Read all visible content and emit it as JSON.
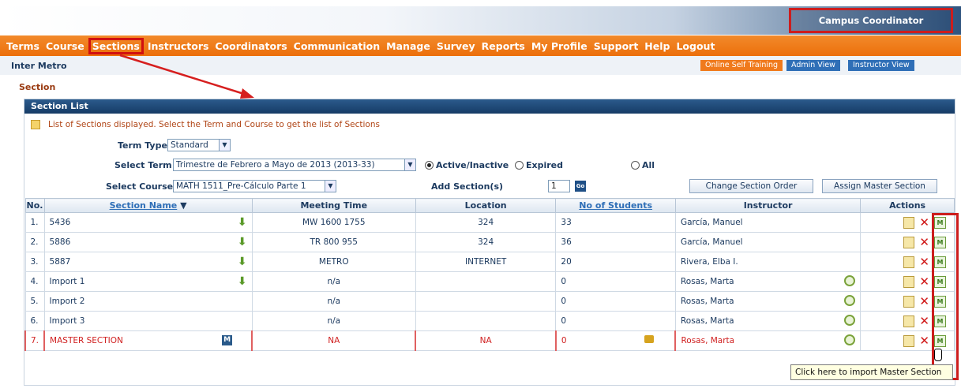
{
  "header": {
    "role": "Campus Coordinator"
  },
  "menu": [
    {
      "label": "Terms"
    },
    {
      "label": "Course"
    },
    {
      "label": "Sections",
      "active": true
    },
    {
      "label": "Instructors"
    },
    {
      "label": "Coordinators"
    },
    {
      "label": "Communication"
    },
    {
      "label": "Manage"
    },
    {
      "label": "Survey"
    },
    {
      "label": "Reports"
    },
    {
      "label": "My Profile"
    },
    {
      "label": "Support"
    },
    {
      "label": "Help"
    },
    {
      "label": "Logout"
    }
  ],
  "subbar": {
    "institution": "Inter Metro",
    "online_training": "Online Self Training",
    "admin_view": "Admin View",
    "instructor_view": "Instructor View"
  },
  "page": {
    "section_label": "Section",
    "panel_title": "Section List",
    "info": "List of Sections displayed. Select the Term and Course to get the list of Sections"
  },
  "form": {
    "term_type_label": "Term Type",
    "term_type_value": "Standard",
    "select_term_label": "Select Term",
    "select_term_value": "Trimestre de Febrero a Mayo de 2013 (2013-33)",
    "radio_active": "Active/Inactive",
    "radio_expired": "Expired",
    "radio_all": "All",
    "select_course_label": "Select Course",
    "select_course_value": "MATH 1511_Pre-Cálculo Parte 1",
    "add_sections_label": "Add Section(s)",
    "add_sections_value": "1",
    "go_label": "Go",
    "change_order_button": "Change Section Order",
    "assign_master_button": "Assign Master Section"
  },
  "table": {
    "headers": {
      "no": "No.",
      "section_name": "Section Name",
      "sort_glyph": "▼",
      "meeting_time": "Meeting Time",
      "location": "Location",
      "students": "No of Students",
      "instructor": "Instructor",
      "actions": "Actions"
    },
    "rows": [
      {
        "no": "1.",
        "name": "5436",
        "meeting": "MW 1600 1755",
        "location": "324",
        "students": "33",
        "instructor": "García, Manuel"
      },
      {
        "no": "2.",
        "name": "5886",
        "meeting": "TR 800 955",
        "location": "324",
        "students": "36",
        "instructor": "García, Manuel"
      },
      {
        "no": "3.",
        "name": "5887",
        "meeting": "METRO",
        "location": "INTERNET",
        "students": "20",
        "instructor": "Rivera, Elba I."
      },
      {
        "no": "4.",
        "name": "Import 1",
        "meeting": "n/a",
        "location": "",
        "students": "0",
        "instructor": "Rosas, Marta"
      },
      {
        "no": "5.",
        "name": "Import 2",
        "meeting": "n/a",
        "location": "",
        "students": "0",
        "instructor": "Rosas, Marta"
      },
      {
        "no": "6.",
        "name": "Import 3",
        "meeting": "n/a",
        "location": "",
        "students": "0",
        "instructor": "Rosas, Marta"
      },
      {
        "no": "7.",
        "name": "MASTER SECTION",
        "meeting": "NA",
        "location": "NA",
        "students": "0",
        "instructor": "Rosas, Marta"
      }
    ],
    "master_badge": "M",
    "import_icon_text": "M"
  },
  "tooltip": "Click here to import Master Section",
  "colors": {
    "menu_orange": "#ec6f0b",
    "header_blue": "#163c66",
    "highlight_red": "#cc1d1d",
    "master_red": "#d02020"
  },
  "icons": [
    "down-arrow-icon",
    "master-badge-icon",
    "clock-icon",
    "lock-icon",
    "edit-icon",
    "delete-icon",
    "import-master-icon",
    "note-icon",
    "hand-cursor-icon"
  ]
}
